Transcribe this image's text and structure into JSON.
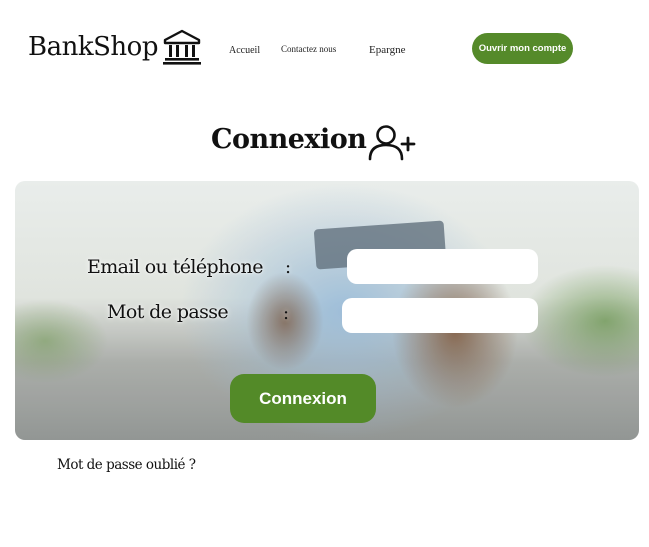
{
  "brand": {
    "name": "BankShop",
    "icon": "bank-icon"
  },
  "nav": {
    "accueil": "Accueil",
    "contact": "Contactez nous",
    "epargne": "Epargne"
  },
  "cta": {
    "label": "Ouvrir mon compte",
    "color": "#558a2a"
  },
  "page": {
    "title": "Connexion",
    "icon": "user-add-icon"
  },
  "form": {
    "email_label": "Email ou téléphone",
    "password_label": "Mot de passe",
    "separator": ":",
    "email_value": "",
    "password_value": "",
    "submit_label": "Connexion",
    "submit_color": "#538a28"
  },
  "forgot": {
    "label": "Mot de passe oublié ?"
  }
}
